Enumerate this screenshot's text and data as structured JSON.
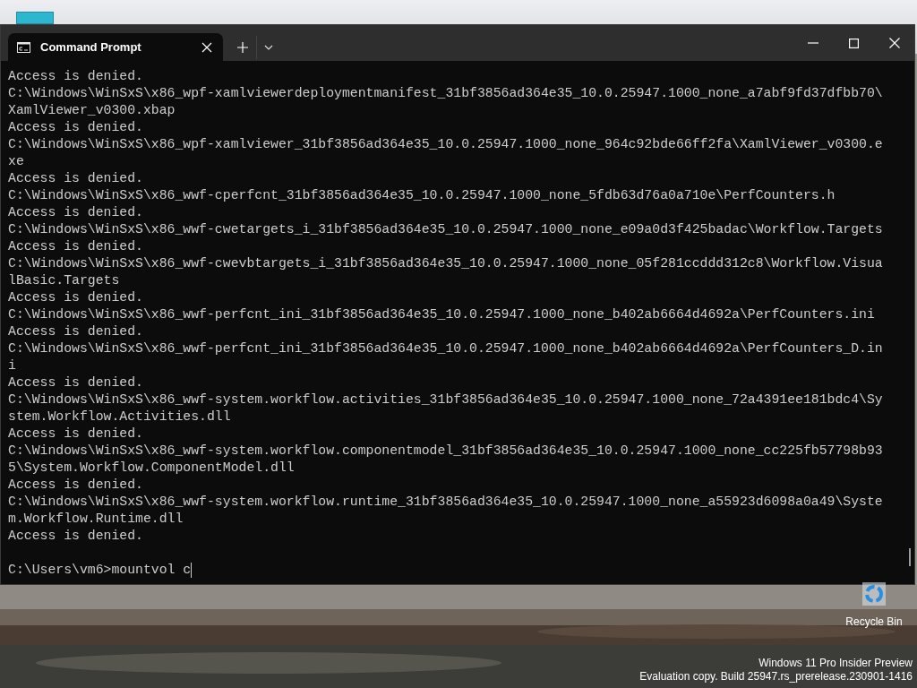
{
  "window": {
    "tab_title": "Command Prompt"
  },
  "terminal": {
    "lines": [
      "Access is denied.",
      "C:\\Windows\\WinSxS\\x86_wpf-xamlviewerdeploymentmanifest_31bf3856ad364e35_10.0.25947.1000_none_a7abf9fd37dfbb70\\",
      "XamlViewer_v0300.xbap",
      "Access is denied.",
      "C:\\Windows\\WinSxS\\x86_wpf-xamlviewer_31bf3856ad364e35_10.0.25947.1000_none_964c92bde66ff2fa\\XamlViewer_v0300.e",
      "xe",
      "Access is denied.",
      "C:\\Windows\\WinSxS\\x86_wwf-cperfcnt_31bf3856ad364e35_10.0.25947.1000_none_5fdb63d76a0a710e\\PerfCounters.h",
      "Access is denied.",
      "C:\\Windows\\WinSxS\\x86_wwf-cwetargets_i_31bf3856ad364e35_10.0.25947.1000_none_e09a0d3f425badac\\Workflow.Targets",
      "Access is denied.",
      "C:\\Windows\\WinSxS\\x86_wwf-cwevbtargets_i_31bf3856ad364e35_10.0.25947.1000_none_05f281ccddd312c8\\Workflow.Visua",
      "lBasic.Targets",
      "Access is denied.",
      "C:\\Windows\\WinSxS\\x86_wwf-perfcnt_ini_31bf3856ad364e35_10.0.25947.1000_none_b402ab6664d4692a\\PerfCounters.ini",
      "Access is denied.",
      "C:\\Windows\\WinSxS\\x86_wwf-perfcnt_ini_31bf3856ad364e35_10.0.25947.1000_none_b402ab6664d4692a\\PerfCounters_D.in",
      "i",
      "Access is denied.",
      "C:\\Windows\\WinSxS\\x86_wwf-system.workflow.activities_31bf3856ad364e35_10.0.25947.1000_none_72a4391ee181bdc4\\Sy",
      "stem.Workflow.Activities.dll",
      "Access is denied.",
      "C:\\Windows\\WinSxS\\x86_wwf-system.workflow.componentmodel_31bf3856ad364e35_10.0.25947.1000_none_cc225fb57798b93",
      "5\\System.Workflow.ComponentModel.dll",
      "Access is denied.",
      "C:\\Windows\\WinSxS\\x86_wwf-system.workflow.runtime_31bf3856ad364e35_10.0.25947.1000_none_a55923d6098a0a49\\Syste",
      "m.Workflow.Runtime.dll",
      "Access is denied."
    ],
    "prompt": "C:\\Users\\vm6>mountvol c"
  },
  "desktop": {
    "icons": [
      {
        "label": "Recycle Bin"
      }
    ],
    "watermark_lines": [
      "Windows 11 Pro Insider Preview",
      "Evaluation copy. Build 25947.rs_prerelease.230901-1416"
    ]
  }
}
